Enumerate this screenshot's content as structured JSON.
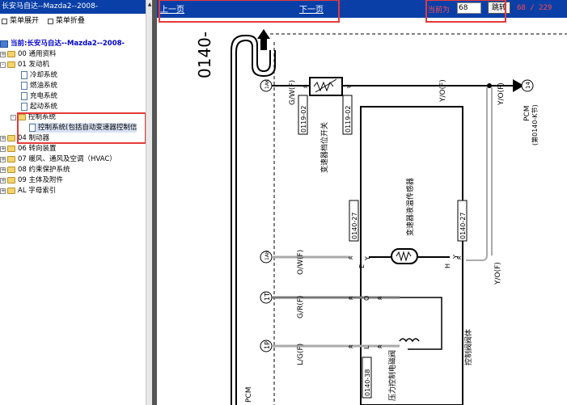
{
  "left_panel": {
    "title": "长安马自达--Mazda2--2008-",
    "toolbar": {
      "expand_label": "菜单展开",
      "collapse_label": "菜单折叠"
    },
    "tree": {
      "root": "当前:长安马自达--Mazda2--2008-",
      "items": [
        {
          "label": "00 通用资料"
        },
        {
          "label": "01 发动机"
        },
        {
          "label": "冷却系统"
        },
        {
          "label": "燃油系统"
        },
        {
          "label": "充电系统"
        },
        {
          "label": "起动系统"
        },
        {
          "label": "控制系统"
        },
        {
          "label": "控制系统(包括自动变速器控制信"
        },
        {
          "label": "04 制动器"
        },
        {
          "label": "06 转向装置"
        },
        {
          "label": "07 暖风、通风及空调（HVAC）"
        },
        {
          "label": "08 约束保护系统"
        },
        {
          "label": "09 主体及附件"
        },
        {
          "label": "AL 字母索引"
        }
      ]
    }
  },
  "viewer": {
    "prev_label": "上一页",
    "next_label": "下一页",
    "current_label": "当前为",
    "current_page": "68",
    "jump_label": "跳转",
    "page_count": "68 / 229"
  },
  "diagram": {
    "page_ref": "0140-",
    "connector_refs": [
      "0119-02",
      "0119-02",
      "0140-27",
      "0140-27",
      "0140-38"
    ],
    "pins": [
      "1AK",
      "1AH",
      "1T",
      "1P",
      "14"
    ],
    "wires": [
      "G/W(F)",
      "O/W(F)",
      "G/R(F)",
      "L/G(F)",
      "Y/O(F)",
      "Y/O(F)",
      "Y/O(F)"
    ],
    "pin_letters": [
      "E",
      "Y",
      "H",
      "Y",
      "O",
      "L"
    ],
    "pcm_ref": "PCM (第0140-K节)",
    "pcm_label_top": "PCM",
    "pcm_label_sub": "(第0140-K节)",
    "pcm_bottom": "PCM",
    "components": {
      "range_switch": "变速器档位开关",
      "fluid_temp": "变速器液温传感器",
      "valve_body": "控制阀阀体",
      "pressure_solenoid": "压力控制电磁阀"
    }
  }
}
